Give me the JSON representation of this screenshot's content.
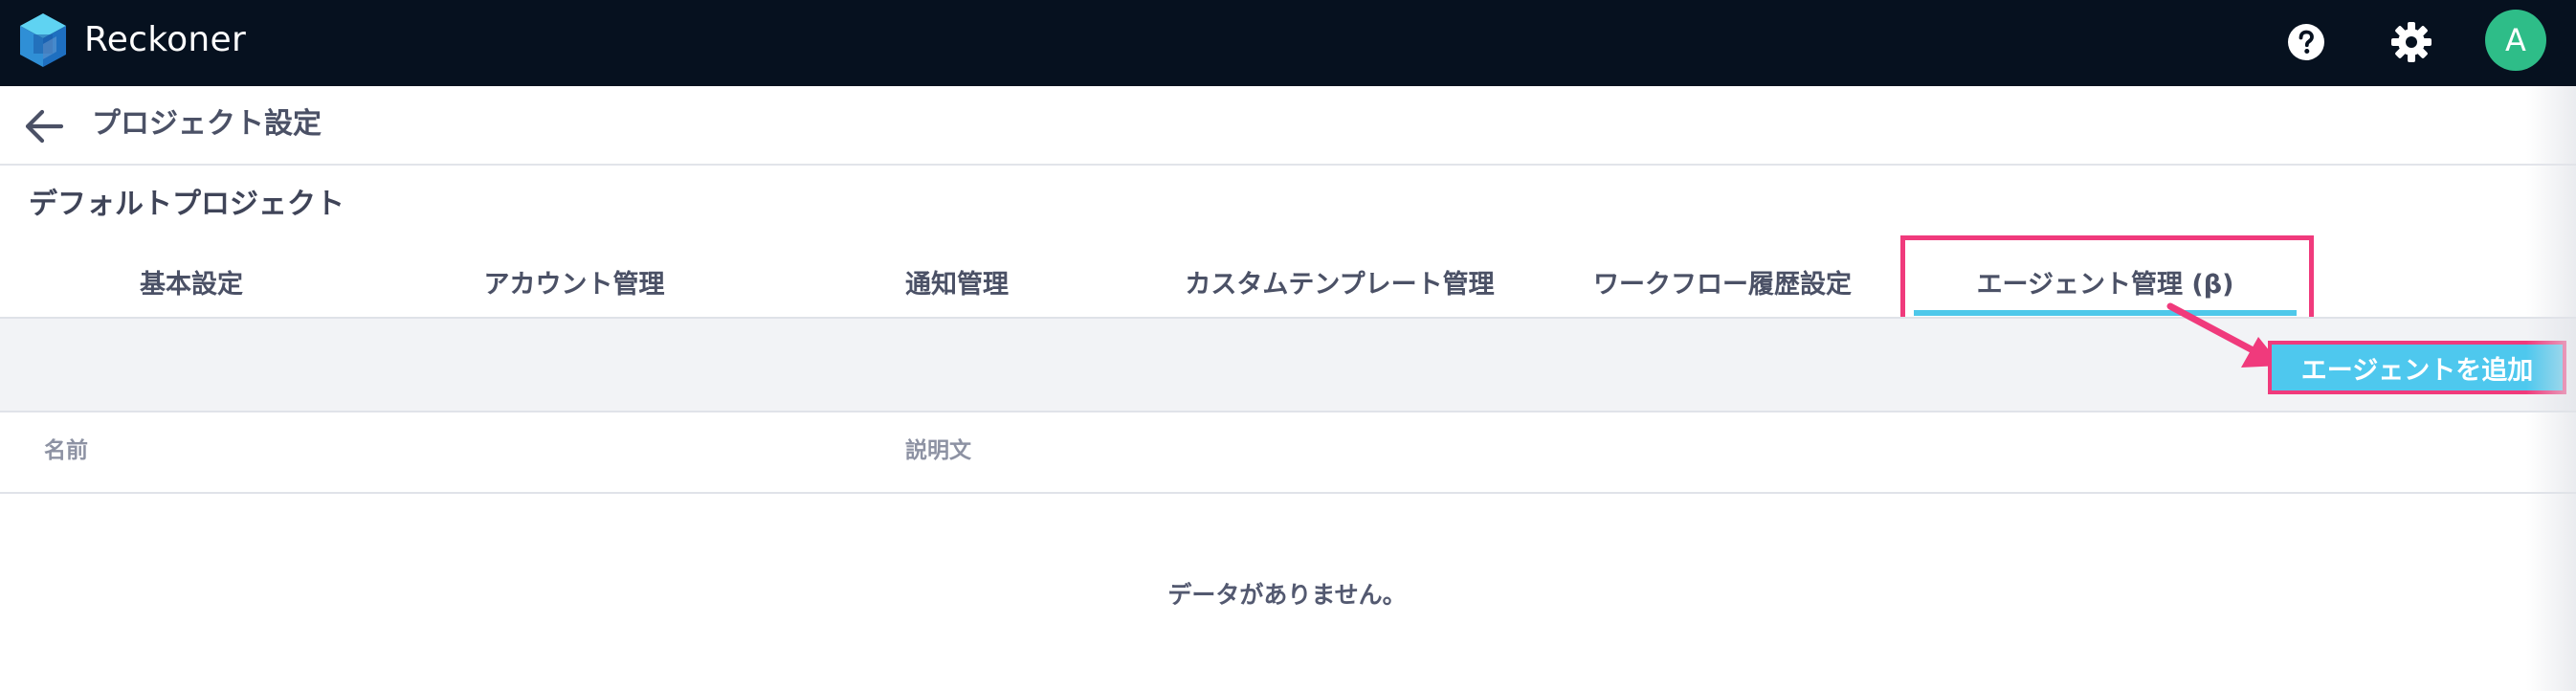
{
  "app": {
    "name": "Reckoner"
  },
  "header": {
    "help_icon": "help-circle-icon",
    "settings_icon": "gear-icon",
    "avatar_initial": "A",
    "avatar_color": "#2ebd88",
    "bar_color": "#06111f"
  },
  "page": {
    "title": "プロジェクト設定",
    "back_icon": "arrow-left-icon"
  },
  "project": {
    "name": "デフォルトプロジェクト"
  },
  "tabs": [
    {
      "label": "基本設定",
      "active": false
    },
    {
      "label": "アカウント管理",
      "active": false
    },
    {
      "label": "通知管理",
      "active": false
    },
    {
      "label": "カスタムテンプレート管理",
      "active": false
    },
    {
      "label": "ワークフロー履歴設定",
      "active": false
    },
    {
      "label": "エージェント管理 (β)",
      "active": true
    }
  ],
  "actions": {
    "add_agent_label": "エージェントを追加",
    "button_color": "#4ec8ee",
    "highlight_color": "#f03a7c"
  },
  "table": {
    "columns": [
      "名前",
      "説明文"
    ],
    "rows": [],
    "empty_message": "データがありません。"
  }
}
